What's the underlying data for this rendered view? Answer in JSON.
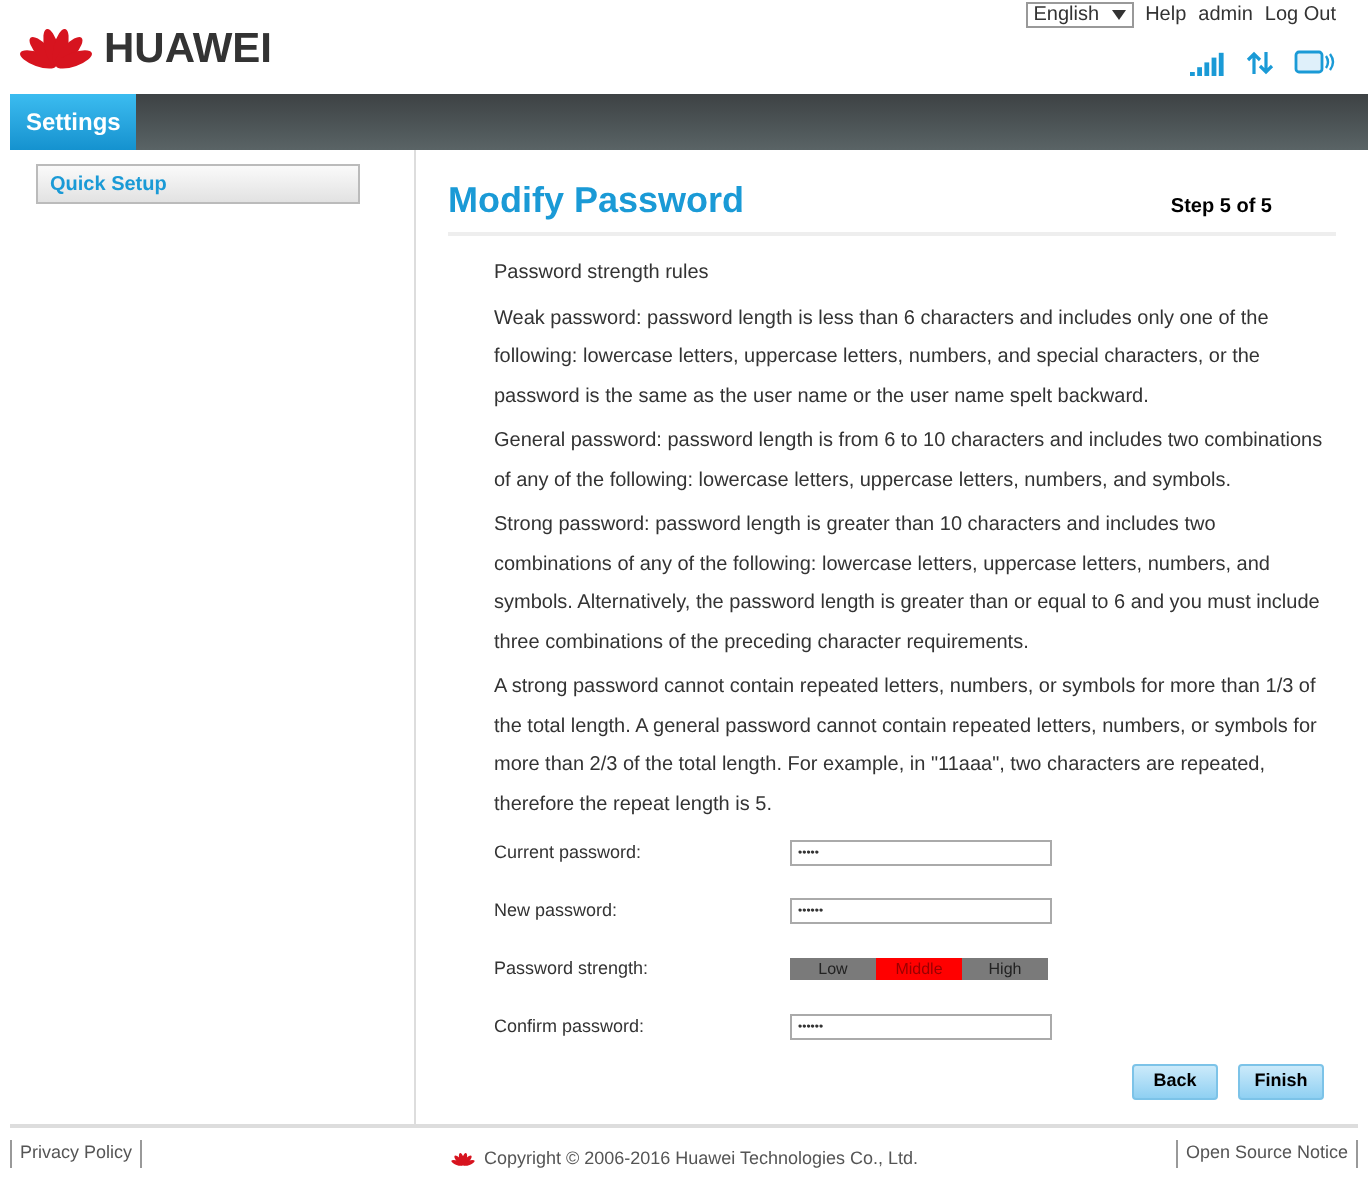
{
  "header": {
    "logo_text": "HUAWEI",
    "language": "English",
    "links": [
      "Help",
      "admin",
      "Log Out"
    ]
  },
  "nav": {
    "tabs": [
      {
        "label": "Settings",
        "selected": true
      }
    ]
  },
  "sidebar": {
    "items": [
      {
        "label": "Quick Setup",
        "selected": true
      }
    ]
  },
  "content": {
    "title": "Modify Password",
    "step": "Step 5 of 5",
    "paragraphs": [
      "Password strength rules",
      "Weak password: password length is less than 6 characters and includes only one of the following: lowercase letters, uppercase letters, numbers, and special characters, or the password is the same as the user name or the user name spelt backward.",
      "General password: password length is from 6 to 10 characters and includes two combinations of any of the following: lowercase letters, uppercase letters, numbers, and symbols.",
      "Strong password: password length is greater than 10 characters and includes two combinations of any of the following: lowercase letters, uppercase letters, numbers, and symbols. Alternatively, the password length is greater than or equal to 6 and you must include three combinations of the preceding character requirements.",
      "A strong password cannot contain repeated letters, numbers, or symbols for more than 1/3 of the total length. A general password cannot contain repeated letters, numbers, or symbols for more than 2/3 of the total length. For example, in \"11aaa\", two characters are repeated, therefore the repeat length is 5."
    ],
    "form": [
      {
        "kind": "field",
        "label": "Current password:",
        "value": "•••••"
      },
      {
        "kind": "field",
        "label": "New password:",
        "value": "••••••"
      },
      {
        "kind": "strength",
        "label": "Password strength:",
        "segments": [
          {
            "label": "Low",
            "selected": false
          },
          {
            "label": "Middle",
            "selected": true
          },
          {
            "label": "High",
            "selected": false
          }
        ]
      },
      {
        "kind": "field",
        "label": "Confirm password:",
        "value": "••••••"
      }
    ],
    "buttons": [
      "Back",
      "Finish"
    ]
  },
  "footer": {
    "left": "Privacy Policy",
    "copyright": "Copyright © 2006-2016 Huawei Technologies Co., Ltd.",
    "right": "Open Source Notice"
  }
}
